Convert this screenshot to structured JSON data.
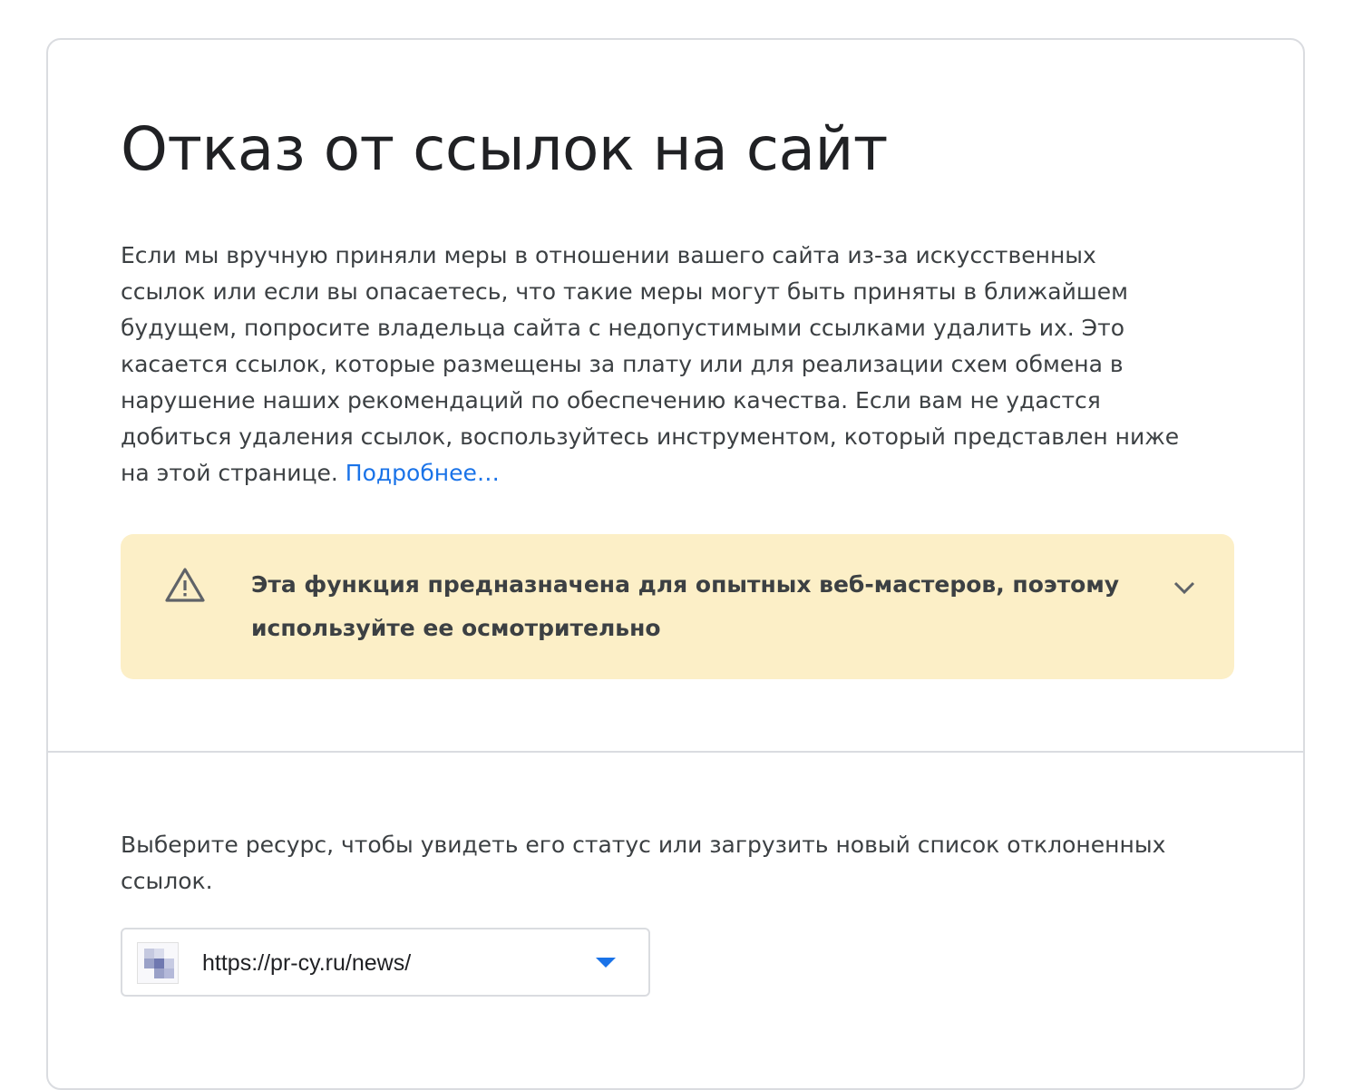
{
  "header": {
    "title": "Отказ от ссылок на сайт"
  },
  "intro": {
    "text": "Если мы вручную приняли меры в отношении вашего сайта из-за искусственных ссылок или если вы опасаетесь, что такие меры могут быть приняты в ближайшем будущем, попросите владельца сайта с недопустимыми ссылками удалить их. Это касается ссылок, которые размещены за плату или для реализации схем обмена в нарушение наших рекомендаций по обеспечению качества. Если вам не удастся добиться удаления ссылок, воспользуйтесь инструментом, который представлен ниже на этой странице.",
    "more_link": "Подробнее…"
  },
  "warning": {
    "icon": "warning-triangle-icon",
    "text": "Эта функция предназначена для опытных веб-мастеров, поэтому используйте ее осмотрительно",
    "expand_icon": "chevron-down-icon"
  },
  "resource": {
    "prompt": "Выберите ресурс, чтобы увидеть его статус или загрузить новый список отклоненных ссылок.",
    "selected_url": "https://pr-cy.ru/news/"
  },
  "colors": {
    "accent": "#1a73e8",
    "warning_bg": "#fcefc7",
    "border": "#dadce0",
    "text": "#202124"
  }
}
